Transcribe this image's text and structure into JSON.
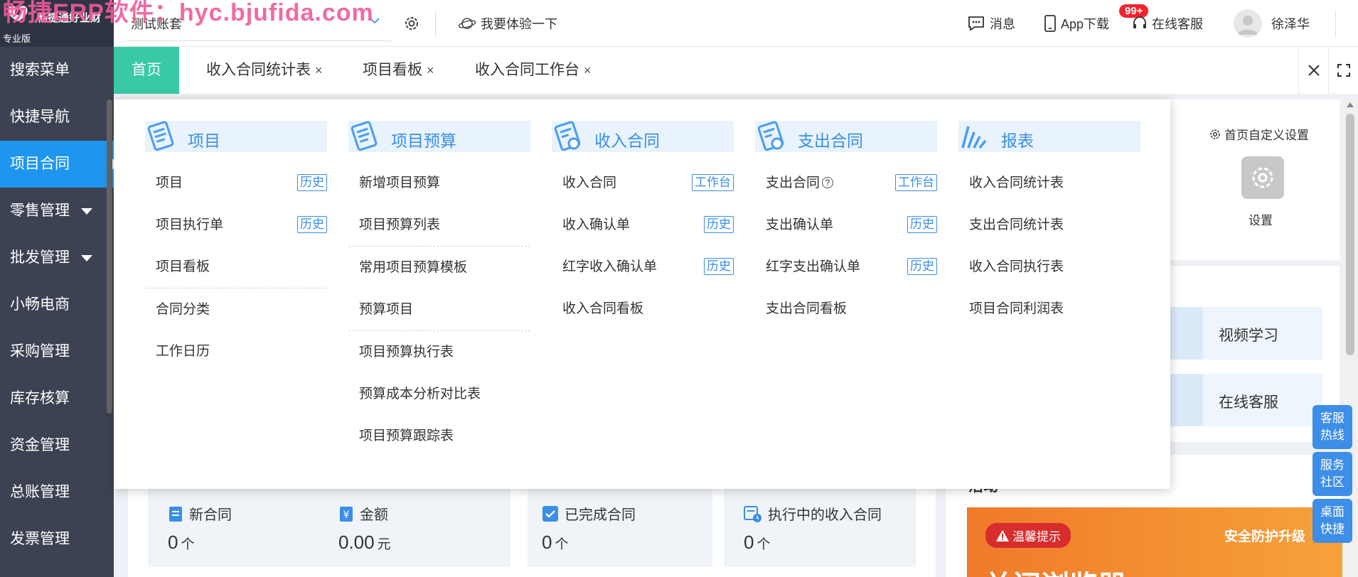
{
  "watermark": "畅捷ERP软件：hyc.bjufida.com",
  "brand": {
    "name": "畅捷通好业财",
    "edition": "专业版"
  },
  "sidebar": {
    "items": [
      {
        "label": "搜索菜单"
      },
      {
        "label": "快捷导航"
      },
      {
        "label": "项目合同"
      },
      {
        "label": "零售管理"
      },
      {
        "label": "批发管理"
      },
      {
        "label": "小畅电商"
      },
      {
        "label": "采购管理"
      },
      {
        "label": "库存核算"
      },
      {
        "label": "资金管理"
      },
      {
        "label": "总账管理"
      },
      {
        "label": "发票管理"
      }
    ]
  },
  "topbar": {
    "account": "测试账套",
    "try_label": "我要体验一下",
    "messages_label": "消息",
    "messages_badge": "99+",
    "app_download": "App下载",
    "online_service": "在线客服",
    "username": "徐泽华"
  },
  "tabs": [
    {
      "label": "首页"
    },
    {
      "label": "收入合同统计表",
      "close": "×"
    },
    {
      "label": "项目看板",
      "close": "×"
    },
    {
      "label": "收入合同工作台",
      "close": "×"
    }
  ],
  "mega": {
    "columns": [
      {
        "title": "项目",
        "items": [
          {
            "label": "项目",
            "tag": "历史"
          },
          {
            "label": "项目执行单",
            "tag": "历史"
          },
          {
            "label": "项目看板"
          },
          {
            "label": "合同分类"
          },
          {
            "label": "工作日历"
          }
        ]
      },
      {
        "title": "项目预算",
        "items": [
          {
            "label": "新增项目预算"
          },
          {
            "label": "项目预算列表"
          },
          {
            "label": "常用项目预算模板"
          },
          {
            "label": "预算项目"
          },
          {
            "label": "项目预算执行表"
          },
          {
            "label": "预算成本分析对比表"
          },
          {
            "label": "项目预算跟踪表"
          }
        ]
      },
      {
        "title": "收入合同",
        "items": [
          {
            "label": "收入合同",
            "tag": "工作台"
          },
          {
            "label": "收入确认单",
            "tag": "历史"
          },
          {
            "label": "红字收入确认单",
            "tag": "历史"
          },
          {
            "label": "收入合同看板"
          }
        ]
      },
      {
        "title": "支出合同",
        "items": [
          {
            "label": "支出合同",
            "tag": "工作台",
            "help": "?"
          },
          {
            "label": "支出确认单",
            "tag": "历史"
          },
          {
            "label": "红字支出确认单",
            "tag": "历史"
          },
          {
            "label": "支出合同看板"
          }
        ]
      },
      {
        "title": "报表",
        "items": [
          {
            "label": "收入合同统计表"
          },
          {
            "label": "支出合同统计表"
          },
          {
            "label": "收入合同执行表"
          },
          {
            "label": "项目合同利润表"
          }
        ]
      }
    ]
  },
  "dashboard": {
    "custom_settings": "首页自定义设置",
    "settings_label": "设置",
    "quick": [
      {
        "label": "视频学习"
      },
      {
        "label": "在线客服"
      }
    ],
    "stats": [
      {
        "label": "新合同",
        "value": "0",
        "unit": "个"
      },
      {
        "label": "金额",
        "value": "0.00",
        "unit": "元"
      },
      {
        "label": "已完成合同",
        "value": "0",
        "unit": "个"
      },
      {
        "label": "执行中的收入合同",
        "value": "0",
        "unit": "个"
      }
    ],
    "activity_title": "活动",
    "banner_tip": "温馨提示",
    "banner_security": "安全防护升级",
    "banner_big": "关闭浏览器"
  },
  "float_buttons": [
    {
      "line1": "客服",
      "line2": "热线"
    },
    {
      "line1": "服务",
      "line2": "社区"
    },
    {
      "line1": "桌面",
      "line2": "快捷"
    }
  ],
  "colors": {
    "sidebar": "#3c4252",
    "active": "#1e96f0",
    "home_tab": "#39c9a5",
    "accent": "#3a8ee6"
  }
}
